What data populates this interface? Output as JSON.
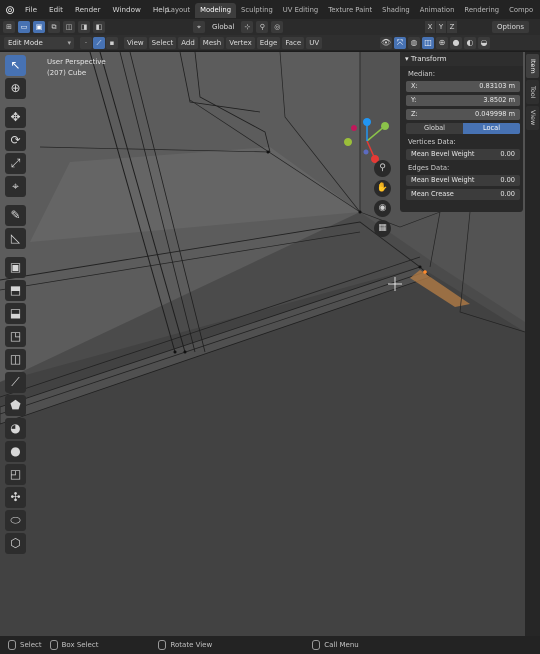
{
  "topbar": {
    "menus": [
      "File",
      "Edit",
      "Render",
      "Window",
      "Help"
    ],
    "workspaces": [
      "Layout",
      "Modeling",
      "Sculpting",
      "UV Editing",
      "Texture Paint",
      "Shading",
      "Animation",
      "Rendering",
      "Compo"
    ],
    "active_workspace": "Modeling"
  },
  "toolrow": {
    "pivot_label": "Global",
    "axes": [
      "X",
      "Y",
      "Z"
    ],
    "options_label": "Options"
  },
  "header": {
    "mode": "Edit Mode",
    "menus": [
      "View",
      "Select",
      "Add",
      "Mesh",
      "Vertex",
      "Edge",
      "Face",
      "UV"
    ]
  },
  "viewport": {
    "perspective": "User Perspective",
    "object": "(207) Cube"
  },
  "toolbar": {
    "tools": [
      "select-box",
      "cursor",
      "move",
      "rotate",
      "scale",
      "transform",
      "annotate",
      "measure",
      "add-cube",
      "extrude",
      "inset",
      "bevel",
      "loop-cut",
      "knife",
      "poly-build",
      "spin",
      "smooth",
      "edge-slide",
      "shrink-fatten",
      "shear",
      "rip"
    ]
  },
  "npanel": {
    "title": "Transform",
    "median_label": "Median:",
    "x_label": "X:",
    "x_value": "0.83103 m",
    "y_label": "Y:",
    "y_value": "3.8502 m",
    "z_label": "Z:",
    "z_value": "0.049998 m",
    "global_label": "Global",
    "local_label": "Local",
    "vertices_data": "Vertices Data:",
    "mean_bevel_weight_v": "Mean Bevel Weight",
    "mean_bevel_weight_v_value": "0.00",
    "edges_data": "Edges Data:",
    "mean_bevel_weight_e": "Mean Bevel Weight",
    "mean_bevel_weight_e_value": "0.00",
    "mean_crease": "Mean Crease",
    "mean_crease_value": "0.00"
  },
  "sidetabs": [
    "Item",
    "Tool",
    "View"
  ],
  "statusbar": {
    "select": "Select",
    "box_select": "Box Select",
    "rotate_view": "Rotate View",
    "call_menu": "Call Menu"
  },
  "colors": {
    "accent": "#4772b3",
    "header_bg": "#232323",
    "viewport_bg": "#4b4b4b"
  }
}
